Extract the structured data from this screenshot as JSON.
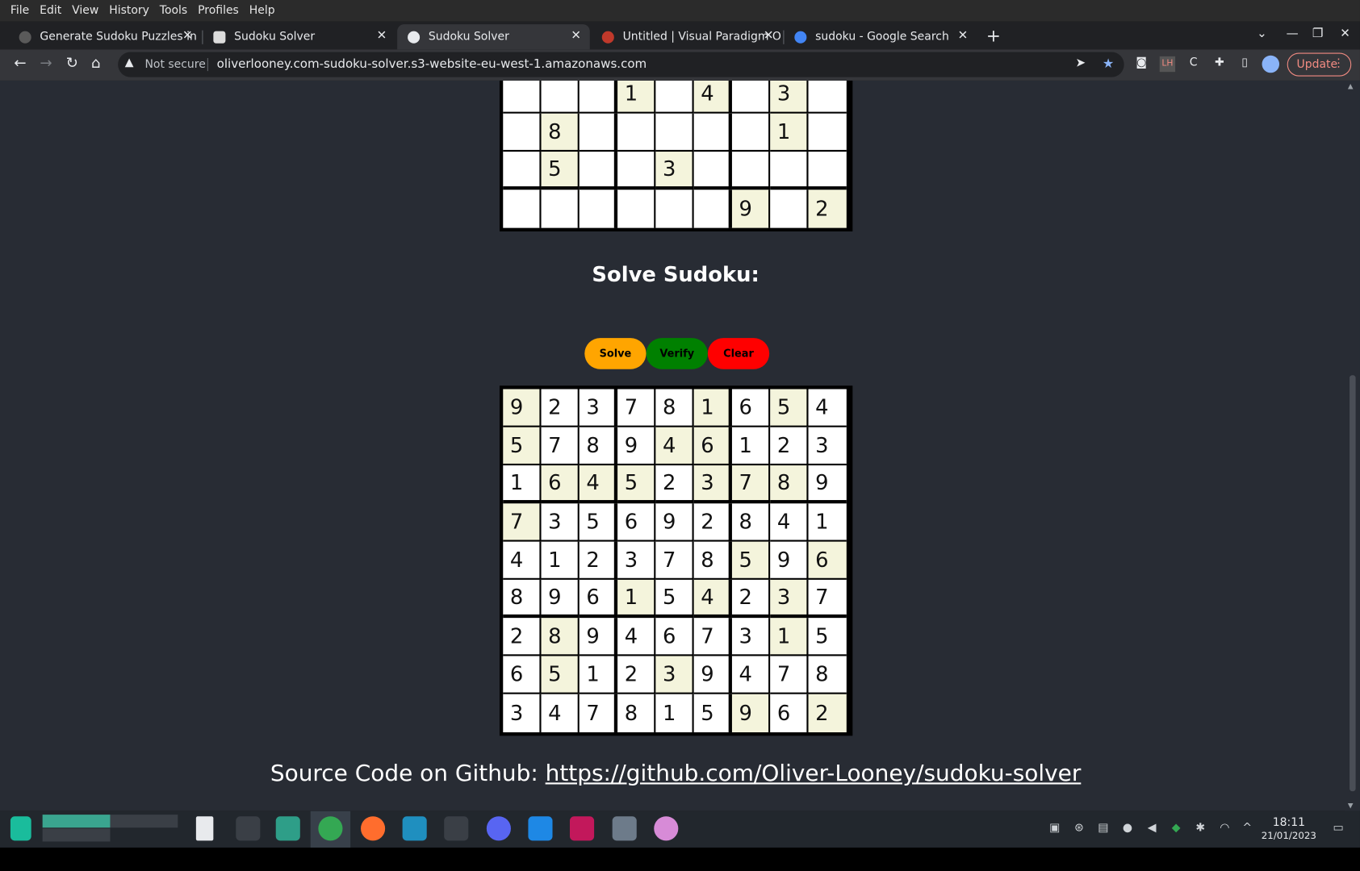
{
  "menu": [
    "File",
    "Edit",
    "View",
    "History",
    "Tools",
    "Profiles",
    "Help"
  ],
  "tabs": [
    {
      "title": "Generate Sudoku Puzzles in F",
      "color": "#4a4a4a",
      "active": false
    },
    {
      "title": "Sudoku Solver",
      "color": "#dcdcdc",
      "active": false
    },
    {
      "title": "Sudoku Solver",
      "color": "#ffffff",
      "active": true
    },
    {
      "title": "Untitled | Visual Paradigm O",
      "color": "#c0392b",
      "active": false
    },
    {
      "title": "sudoku - Google Search",
      "color": "#4285f4",
      "active": false
    }
  ],
  "toolbar": {
    "not_secure": "Not secure",
    "url": "oliverlooney.com-sudoku-solver.s3-website-eu-west-1.amazonaws.com",
    "update_label": "Update"
  },
  "page": {
    "heading": "Solve Sudoku:",
    "buttons": {
      "solve": "Solve",
      "verify": "Verify",
      "clear": "Clear"
    },
    "source_prefix": "Source Code on Github: ",
    "source_link": "https://github.com/Oliver-Looney/sudoku-solver"
  },
  "puzzle_partial": {
    "rows": [
      [
        "",
        "",
        "",
        "1",
        "",
        "4",
        "",
        "3",
        ""
      ],
      [
        "",
        "8",
        "",
        "",
        "",
        "",
        "",
        "1",
        ""
      ],
      [
        "",
        "5",
        "",
        "",
        "3",
        "",
        "",
        "",
        ""
      ],
      [
        "",
        "",
        "",
        "",
        "",
        "",
        "9",
        "",
        "2"
      ]
    ],
    "given": [
      [
        0,
        0,
        0,
        1,
        0,
        1,
        0,
        1,
        0
      ],
      [
        0,
        1,
        0,
        0,
        0,
        0,
        0,
        1,
        0
      ],
      [
        0,
        1,
        0,
        0,
        1,
        0,
        0,
        0,
        0
      ],
      [
        0,
        0,
        0,
        0,
        0,
        0,
        1,
        0,
        1
      ]
    ]
  },
  "solution": {
    "rows": [
      [
        "9",
        "2",
        "3",
        "7",
        "8",
        "1",
        "6",
        "5",
        "4"
      ],
      [
        "5",
        "7",
        "8",
        "9",
        "4",
        "6",
        "1",
        "2",
        "3"
      ],
      [
        "1",
        "6",
        "4",
        "5",
        "2",
        "3",
        "7",
        "8",
        "9"
      ],
      [
        "7",
        "3",
        "5",
        "6",
        "9",
        "2",
        "8",
        "4",
        "1"
      ],
      [
        "4",
        "1",
        "2",
        "3",
        "7",
        "8",
        "5",
        "9",
        "6"
      ],
      [
        "8",
        "9",
        "6",
        "1",
        "5",
        "4",
        "2",
        "3",
        "7"
      ],
      [
        "2",
        "8",
        "9",
        "4",
        "6",
        "7",
        "3",
        "1",
        "5"
      ],
      [
        "6",
        "5",
        "1",
        "2",
        "3",
        "9",
        "4",
        "7",
        "8"
      ],
      [
        "3",
        "4",
        "7",
        "8",
        "1",
        "5",
        "9",
        "6",
        "2"
      ]
    ],
    "given": [
      [
        1,
        0,
        0,
        0,
        0,
        1,
        0,
        1,
        0
      ],
      [
        1,
        0,
        0,
        0,
        1,
        1,
        0,
        0,
        0
      ],
      [
        0,
        1,
        1,
        1,
        0,
        1,
        1,
        1,
        0
      ],
      [
        1,
        0,
        0,
        0,
        0,
        0,
        0,
        0,
        0
      ],
      [
        0,
        0,
        0,
        0,
        0,
        0,
        1,
        0,
        1
      ],
      [
        0,
        0,
        0,
        1,
        0,
        1,
        0,
        1,
        0
      ],
      [
        0,
        1,
        0,
        0,
        0,
        0,
        0,
        1,
        0
      ],
      [
        0,
        1,
        0,
        0,
        1,
        0,
        0,
        0,
        0
      ],
      [
        0,
        0,
        0,
        0,
        0,
        0,
        1,
        0,
        1
      ]
    ]
  },
  "tray": {
    "time": "18:11",
    "date": "21/01/2023"
  }
}
